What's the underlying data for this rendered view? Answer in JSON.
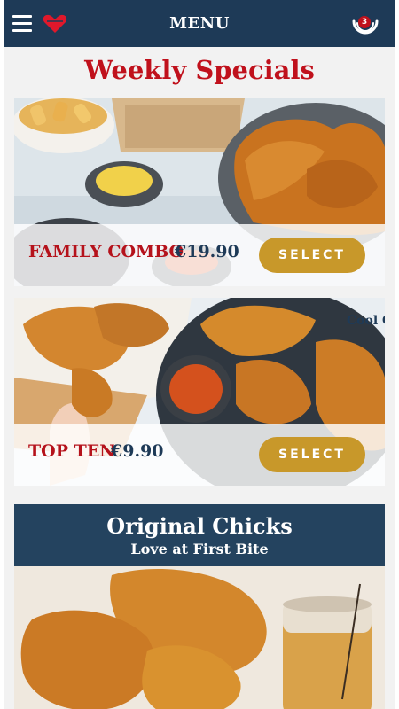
{
  "header": {
    "title": "MENU",
    "menu_icon": "hamburger-menu-icon",
    "logo_icon": "heart-logo-icon",
    "cart_icon": "cart-icon",
    "cart_count": "3"
  },
  "section": {
    "title": "Weekly Specials"
  },
  "specials": [
    {
      "name": "FAMILY COMBO",
      "price": "€19.90",
      "button": "SELECT"
    },
    {
      "name": "TOP TEN",
      "price": "€9.90",
      "button": "SELECT"
    }
  ],
  "promo": {
    "title": "Original Chicks",
    "subtitle": "Love at First Bite"
  },
  "colors": {
    "header_bg": "#1e3a57",
    "accent_red": "#c0111c",
    "button_gold": "#c8982a",
    "price_navy": "#1e3a57"
  }
}
